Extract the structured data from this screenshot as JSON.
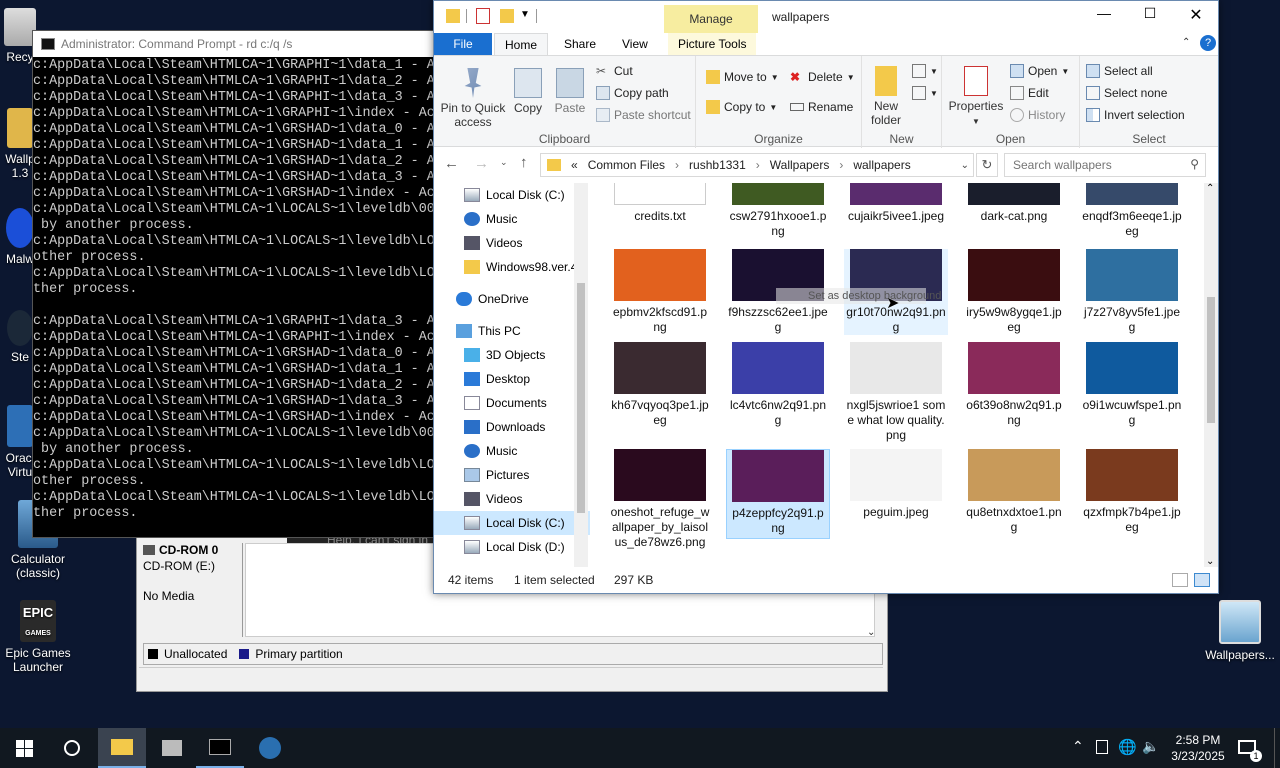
{
  "desktop": {
    "icons": [
      {
        "label": "Recycle Bin"
      },
      {
        "label": "Wallpaper Engine 1.3"
      },
      {
        "label": "Malwarebytes"
      },
      {
        "label": "Steam"
      },
      {
        "label": "Oracle VM VirtualBox"
      },
      {
        "label": "Calculator (classic)"
      },
      {
        "label": "Epic Games Launcher"
      },
      {
        "label": "Wallpapers..."
      }
    ],
    "recycle_trunc": "Recy",
    "wallpaper_trunc": "Wallp",
    "wallpaper_trunc2": "1.3",
    "malware_trunc": "Malw",
    "steam_trunc": "Ste",
    "oracle_trunc": "Oracl",
    "oracle_trunc2": "Virtu",
    "calc_label": "Calculator (classic)",
    "epic_label": "Epic Games Launcher",
    "epic_logo": "EPIC",
    "epic_logo_sub": "GAMES",
    "wallpapers_shortcut": "Wallpapers..."
  },
  "cmd": {
    "title": "Administrator: Command Prompt - rd  c:/q /s",
    "lines": [
      "c:AppData\\Local\\Steam\\HTMLCA~1\\GRAPHI~1\\data_1 - A",
      "c:AppData\\Local\\Steam\\HTMLCA~1\\GRAPHI~1\\data_2 - A",
      "c:AppData\\Local\\Steam\\HTMLCA~1\\GRAPHI~1\\data_3 - A",
      "c:AppData\\Local\\Steam\\HTMLCA~1\\GRAPHI~1\\index - Ac",
      "c:AppData\\Local\\Steam\\HTMLCA~1\\GRSHAD~1\\data_0 - A",
      "c:AppData\\Local\\Steam\\HTMLCA~1\\GRSHAD~1\\data_1 - A",
      "c:AppData\\Local\\Steam\\HTMLCA~1\\GRSHAD~1\\data_2 - A",
      "c:AppData\\Local\\Steam\\HTMLCA~1\\GRSHAD~1\\data_3 - A",
      "c:AppData\\Local\\Steam\\HTMLCA~1\\GRSHAD~1\\index - Ac",
      "c:AppData\\Local\\Steam\\HTMLCA~1\\LOCALS~1\\leveldb\\00",
      " by another process.",
      "c:AppData\\Local\\Steam\\HTMLCA~1\\LOCALS~1\\leveldb\\LO",
      "other process.",
      "c:AppData\\Local\\Steam\\HTMLCA~1\\LOCALS~1\\leveldb\\LO",
      "ther process.",
      "",
      "c:AppData\\Local\\Steam\\HTMLCA~1\\GRAPHI~1\\data_3 - A",
      "c:AppData\\Local\\Steam\\HTMLCA~1\\GRAPHI~1\\index - Ac",
      "c:AppData\\Local\\Steam\\HTMLCA~1\\GRSHAD~1\\data_0 - A",
      "c:AppData\\Local\\Steam\\HTMLCA~1\\GRSHAD~1\\data_1 - A",
      "c:AppData\\Local\\Steam\\HTMLCA~1\\GRSHAD~1\\data_2 - A",
      "c:AppData\\Local\\Steam\\HTMLCA~1\\GRSHAD~1\\data_3 - A",
      "c:AppData\\Local\\Steam\\HTMLCA~1\\GRSHAD~1\\index - Ac",
      "c:AppData\\Local\\Steam\\HTMLCA~1\\LOCALS~1\\leveldb\\00",
      " by another process.",
      "c:AppData\\Local\\Steam\\HTMLCA~1\\LOCALS~1\\leveldb\\LO",
      "other process.",
      "c:AppData\\Local\\Steam\\HTMLCA~1\\LOCALS~1\\leveldb\\LO",
      "ther process."
    ]
  },
  "diskmgmt": {
    "disk_label": "CD-ROM 0",
    "disk_type": "CD-ROM (E:)",
    "disk_status": "No Media",
    "legend_unallocated": "Unallocated",
    "legend_primary": "Primary partition",
    "help_link": "Help, I can't sign in"
  },
  "explorer": {
    "title": "wallpapers",
    "manage_tab": "Manage",
    "tabs": [
      "File",
      "Home",
      "Share",
      "View",
      "Picture Tools"
    ],
    "ribbon": {
      "pin": "Pin to Quick access",
      "pin1": "Pin to Quick",
      "pin2": "access",
      "copy": "Copy",
      "paste": "Paste",
      "cut": "Cut",
      "copy_path": "Copy path",
      "paste_shortcut": "Paste shortcut",
      "clipboard": "Clipboard",
      "move_to": "Move to",
      "copy_to": "Copy to",
      "delete": "Delete",
      "rename": "Rename",
      "organize": "Organize",
      "new_folder1": "New",
      "new_folder2": "folder",
      "new": "New",
      "properties": "Properties",
      "open": "Open",
      "edit": "Edit",
      "history": "History",
      "open_group": "Open",
      "select_all": "Select all",
      "select_none": "Select none",
      "invert": "Invert selection",
      "select": "Select"
    },
    "address": {
      "prefix": "«",
      "crumbs": [
        "Common Files",
        "rushb1331",
        "Wallpapers",
        "wallpapers"
      ],
      "search_placeholder": "Search wallpapers"
    },
    "nav": [
      {
        "label": "Local Disk (C:)",
        "icon": "drive-icon"
      },
      {
        "label": "Music",
        "icon": "music-icon"
      },
      {
        "label": "Videos",
        "icon": "videos-icon"
      },
      {
        "label": "Windows98.ver.4",
        "icon": "folder-icon"
      },
      {
        "label": "OneDrive",
        "icon": "cloud-icon"
      },
      {
        "label": "This PC",
        "icon": "pc-icon"
      },
      {
        "label": "3D Objects",
        "icon": "cube-icon"
      },
      {
        "label": "Desktop",
        "icon": "desktop-icon"
      },
      {
        "label": "Documents",
        "icon": "documents-icon"
      },
      {
        "label": "Downloads",
        "icon": "download-icon"
      },
      {
        "label": "Music",
        "icon": "music-icon"
      },
      {
        "label": "Pictures",
        "icon": "pictures-icon"
      },
      {
        "label": "Videos",
        "icon": "videos-icon"
      },
      {
        "label": "Local Disk (C:)",
        "icon": "drive-icon"
      },
      {
        "label": "Local Disk (D:)",
        "icon": "drive-icon"
      }
    ],
    "files": [
      {
        "name": "credits.txt",
        "color": "#ffffff"
      },
      {
        "name": "csw2791hxooe1.png",
        "color": "#3f5a22"
      },
      {
        "name": "cujaikr5ivee1.jpeg",
        "color": "#5a2c6e"
      },
      {
        "name": "dark-cat.png",
        "color": "#1a1e2c"
      },
      {
        "name": "enqdf3m6eeqe1.jpeg",
        "color": "#364a6a"
      },
      {
        "name": "epbmv2kfscd91.png",
        "color": "#e2611e"
      },
      {
        "name": "f9hszzsc62ee1.jpeg",
        "color": "#1a1030"
      },
      {
        "name": "gr10t70nw2q91.png",
        "color": "#2b2a52"
      },
      {
        "name": "iry5w9w8ygqe1.jpeg",
        "color": "#3a0d10"
      },
      {
        "name": "j7z27v8yv5fe1.jpeg",
        "color": "#2e6fa0"
      },
      {
        "name": "kh67vqyoq3pe1.jpeg",
        "color": "#3a2a30"
      },
      {
        "name": "lc4vtc6nw2q91.png",
        "color": "#3b3fa8"
      },
      {
        "name": "nxgl5jswrioe1 some what low quality.png",
        "color": "#e8e8e8"
      },
      {
        "name": "o6t39o8nw2q91.png",
        "color": "#8a2a5a"
      },
      {
        "name": "o9i1wcuwfspe1.png",
        "color": "#0f5a9e"
      },
      {
        "name": "oneshot_refuge_wallpaper_by_laisolus_de78wz6.png",
        "color": "#2a0a1e"
      },
      {
        "name": "p4zeppfcy2q91.png",
        "color": "#5a1e5a"
      },
      {
        "name": "peguim.jpeg",
        "color": "#f4f4f4"
      },
      {
        "name": "qu8etnxdxtoe1.png",
        "color": "#c89a5a"
      },
      {
        "name": "qzxfmpk7b4pe1.jpeg",
        "color": "#7a3a1e"
      }
    ],
    "tooltip": "Set as desktop background",
    "status": {
      "count": "42 items",
      "selected": "1 item selected",
      "size": "297 KB"
    }
  },
  "taskbar": {
    "time": "2:58 PM",
    "date": "3/23/2025",
    "notif_count": "1"
  }
}
